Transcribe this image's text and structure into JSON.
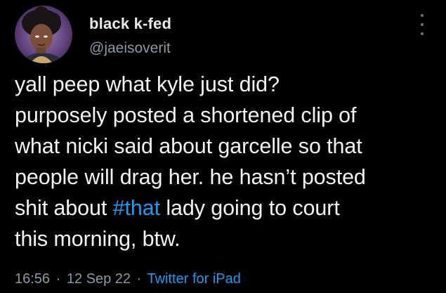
{
  "author": {
    "display_name": "black k-fed",
    "handle": "@jaeisoverit",
    "avatar_icon": "illustrated-avatar-icon"
  },
  "tweet": {
    "lines": [
      "yall peep what kyle just did?",
      "purposely posted a shortened clip of",
      "what nicki said about garcelle so that",
      "people will drag her. he hasn’t posted"
    ],
    "line5_before": "shit about ",
    "hashtag": "#that",
    "line5_after": " lady going to court",
    "line6": "this morning, btw."
  },
  "meta": {
    "time": "16:56",
    "separator": "·",
    "date": "12 Sep 22",
    "source": "Twitter for iPad"
  },
  "colors": {
    "background": "#000000",
    "accent": "#1d9bf0",
    "secondary_text": "#8b98a5"
  },
  "icons": {
    "more": "more-vertical-icon"
  }
}
